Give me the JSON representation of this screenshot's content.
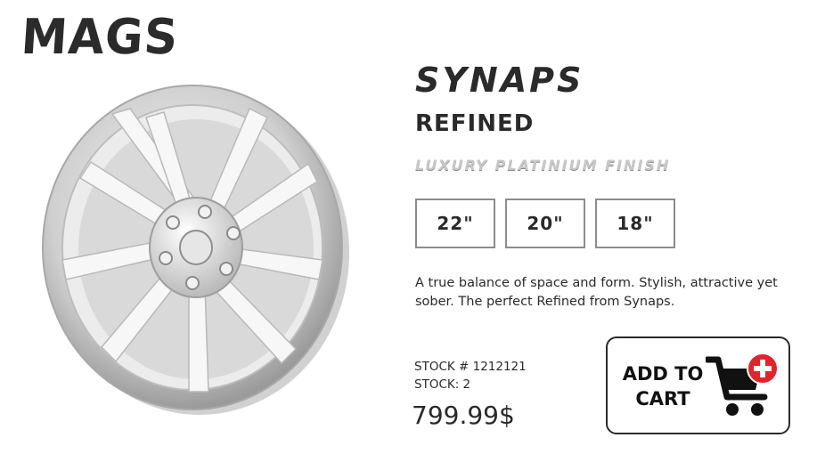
{
  "brand": {
    "logo": "MAGS"
  },
  "product": {
    "name": "SYNAPS",
    "model": "REFINED",
    "finish": "LUXURY PLATINIUM FINISH",
    "sizes": [
      "22\"",
      "20\"",
      "18\""
    ],
    "description": "A true balance of space and form. Stylish, attractive yet sober. The perfect Refined from Synaps.",
    "stock_number": "STOCK # 1212121",
    "stock_qty": "STOCK: 2",
    "price": "799.99$"
  },
  "cart": {
    "label_line1": "ADD TO",
    "label_line2": "CART",
    "icon": "cart-add-icon",
    "badge_color": "#e0242a"
  }
}
